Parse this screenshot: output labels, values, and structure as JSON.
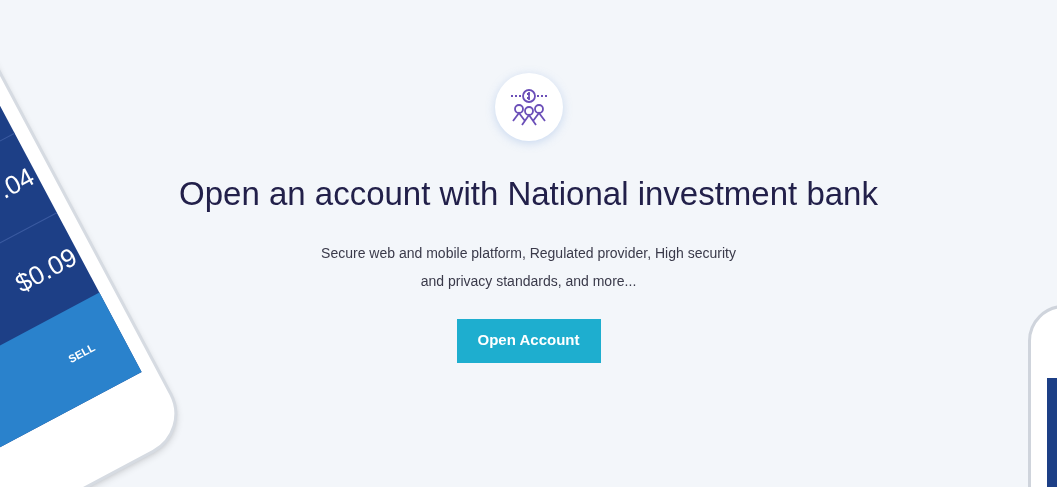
{
  "hero": {
    "title": "Open an account with National investment bank",
    "description": "Secure web and mobile platform, Regulated provider, High security and privacy standards, and more...",
    "button": "Open Account"
  },
  "left_phone": {
    "values": [
      ".04",
      "$0.09"
    ],
    "action": "SELL"
  }
}
